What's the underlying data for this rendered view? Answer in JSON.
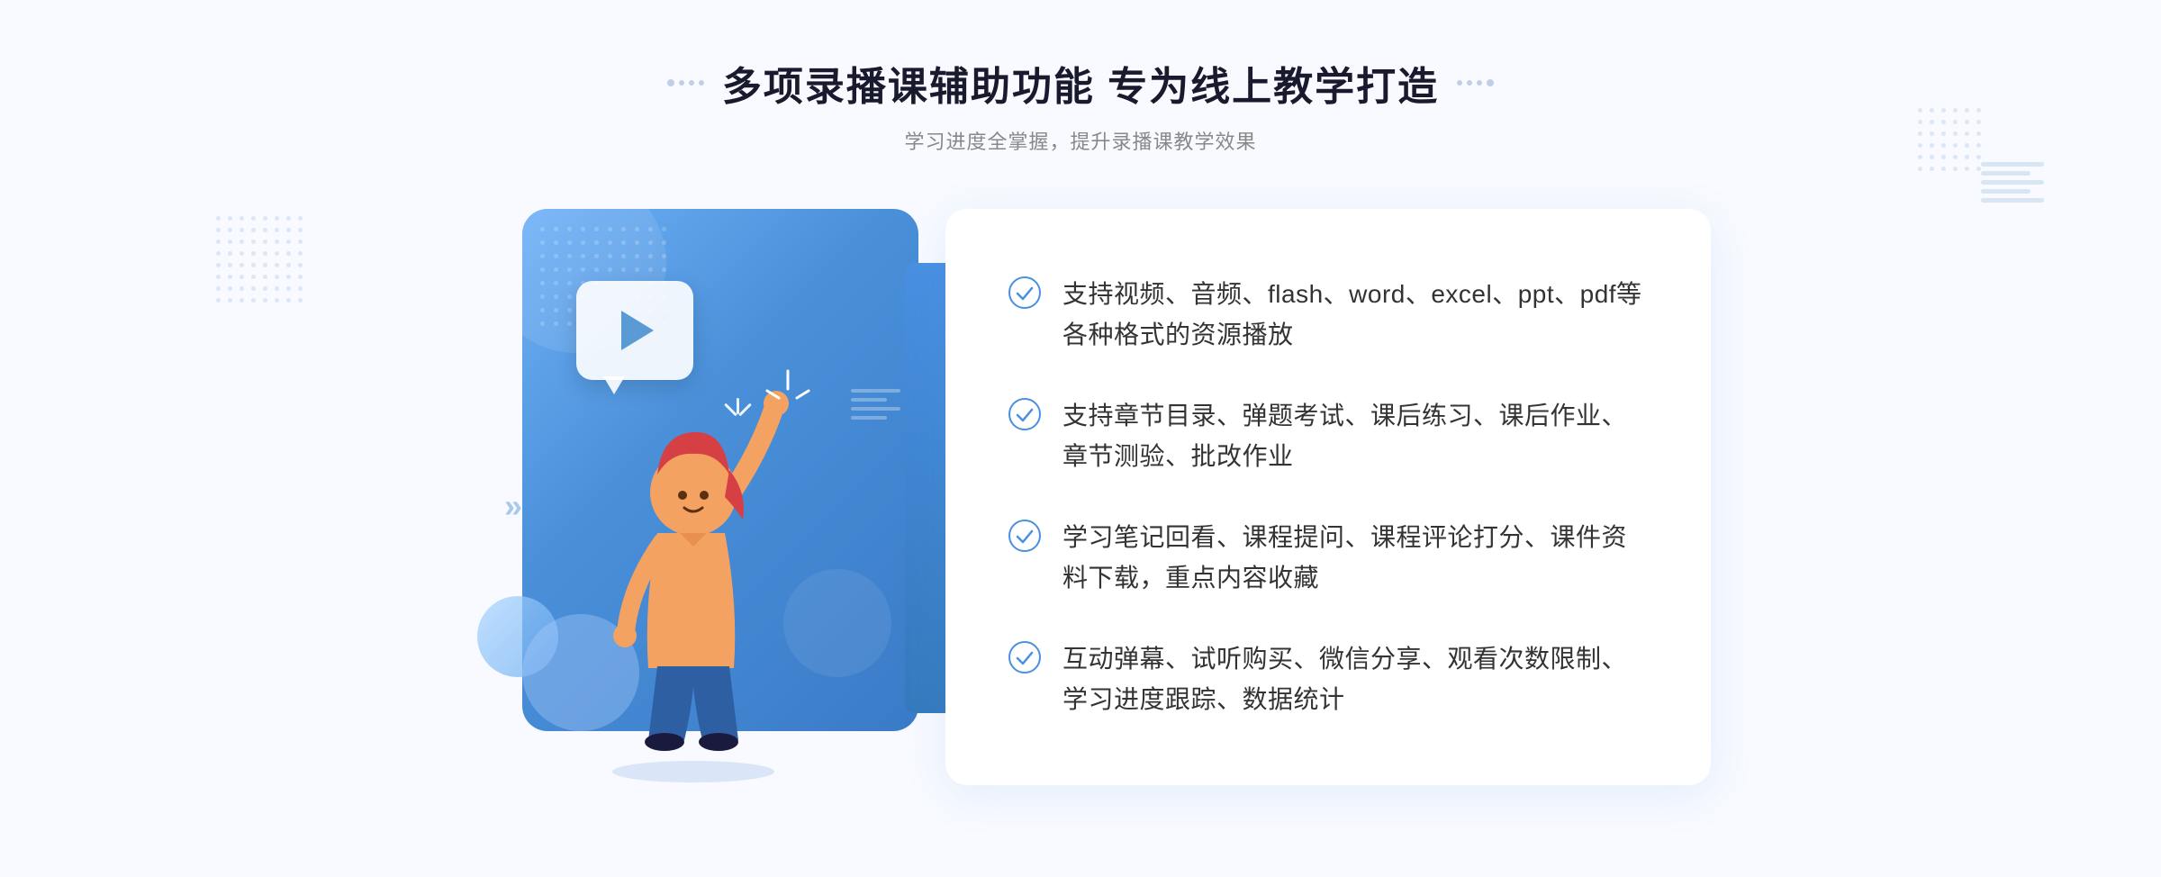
{
  "header": {
    "title": "多项录播课辅助功能 专为线上教学打造",
    "subtitle": "学习进度全掌握，提升录播课教学效果",
    "decorator_left": "❖",
    "decorator_right": "❖"
  },
  "features": [
    {
      "id": 1,
      "text": "支持视频、音频、flash、word、excel、ppt、pdf等各种格式的资源播放"
    },
    {
      "id": 2,
      "text": "支持章节目录、弹题考试、课后练习、课后作业、章节测验、批改作业"
    },
    {
      "id": 3,
      "text": "学习笔记回看、课程提问、课程评论打分、课件资料下载，重点内容收藏"
    },
    {
      "id": 4,
      "text": "互动弹幕、试听购买、微信分享、观看次数限制、学习进度跟踪、数据统计"
    }
  ],
  "colors": {
    "primary_blue": "#4a90e2",
    "light_blue": "#6eb0f7",
    "text_dark": "#1a1a2e",
    "text_gray": "#888888",
    "text_body": "#333333",
    "white": "#ffffff",
    "bg": "#f8faff"
  },
  "left_chevrons": "»",
  "play_label": "▶"
}
